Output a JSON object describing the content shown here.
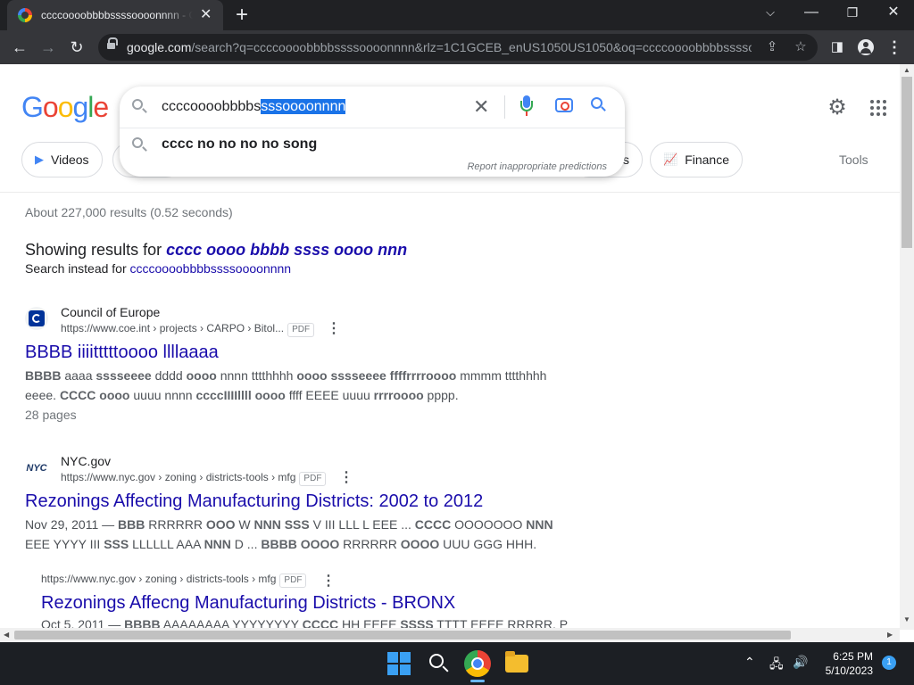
{
  "browser": {
    "tab_title": "ccccoooobbbbssssoooonnnn - Google Search",
    "url_host": "google.com",
    "url_rest": "/search?q=ccccoooobbbbssssoooonnnn&rlz=1C1GCEB_enUS1050US1050&oq=ccccoooobbbbsssso..."
  },
  "search": {
    "query_plain": "ccccoooobbbbs",
    "query_selected": "sssoooonnnn",
    "suggestion": "cccc no no no no song",
    "report": "Report inappropriate predictions"
  },
  "chips": {
    "videos": "Videos",
    "finance": "Finance",
    "partial": "s",
    "tools": "Tools"
  },
  "results_meta": {
    "stats": "About 227,000 results (0.52 seconds)",
    "showing_prefix": "Showing results for ",
    "showing_query": "cccc oooo bbbb ssss oooo nnn",
    "instead_prefix": "Search instead for ",
    "instead_query": "ccccoooobbbbssssoooonnnn"
  },
  "results": [
    {
      "site": "Council of Europe",
      "url": "https://www.coe.int › projects › CARPO › Bitol...",
      "badge": "PDF",
      "title": "BBBB iiiitttttoooo llllaaaa",
      "line1_parts": [
        [
          "BBBB",
          true
        ],
        [
          " aaaa ",
          false
        ],
        [
          "sssseeee",
          true
        ],
        [
          " dddd ",
          false
        ],
        [
          "oooo",
          true
        ],
        [
          " nnnn tttthhhh ",
          false
        ],
        [
          "oooo sssseeee ffffrrrroooo",
          true
        ],
        [
          " mmmm tttthhhh",
          false
        ]
      ],
      "line2_parts": [
        [
          "eeee. ",
          false
        ],
        [
          "CCCC oooo",
          true
        ],
        [
          " uuuu nnnn ",
          false
        ],
        [
          "ccccIIIIllll oooo",
          true
        ],
        [
          " ffff EEEE uuuu ",
          false
        ],
        [
          "rrrroooo",
          true
        ],
        [
          " pppp.",
          false
        ]
      ],
      "extra": "28 pages"
    },
    {
      "site": "NYC.gov",
      "url": "https://www.nyc.gov › zoning › districts-tools › mfg",
      "badge": "PDF",
      "title": "Rezonings Affecting Manufacturing Districts: 2002 to 2012",
      "line1_parts": [
        [
          "Nov 29, 2011 — ",
          false
        ],
        [
          "BBB",
          true
        ],
        [
          " RRRRRR ",
          false
        ],
        [
          "OOO",
          true
        ],
        [
          " W ",
          false
        ],
        [
          "NNN SSS",
          true
        ],
        [
          " V III LLL L EEE ... ",
          false
        ],
        [
          "CCCC",
          true
        ],
        [
          " OOOOOOO ",
          false
        ],
        [
          "NNN",
          true
        ]
      ],
      "line2_parts": [
        [
          "EEE YYYY III ",
          false
        ],
        [
          "SSS",
          true
        ],
        [
          " LLLLLL AAA ",
          false
        ],
        [
          "NNN",
          true
        ],
        [
          " D ... ",
          false
        ],
        [
          "BBBB OOOO",
          true
        ],
        [
          " RRRRRR ",
          false
        ],
        [
          "OOOO",
          true
        ],
        [
          " UUU GGG HHH.",
          false
        ]
      ]
    },
    {
      "url": "https://www.nyc.gov › zoning › districts-tools › mfg",
      "badge": "PDF",
      "title": "Rezonings Affecng Manufacturing Districts - BRONX",
      "line1_parts": [
        [
          "Oct 5, 2011 — ",
          false
        ],
        [
          "BBBB",
          true
        ],
        [
          " AAAAAAAA YYYYYYYY ",
          false
        ],
        [
          "CCCC",
          true
        ],
        [
          " HH EEEE ",
          false
        ],
        [
          "SSSS",
          true
        ],
        [
          " TTTT EEEE RRRRR, P",
          false
        ]
      ]
    }
  ],
  "taskbar": {
    "time": "6:25 PM",
    "date": "5/10/2023",
    "notifications": "1"
  },
  "colors": {
    "link": "#1a0dab",
    "selection": "#1a73e8",
    "chrome_dark": "#202124"
  }
}
